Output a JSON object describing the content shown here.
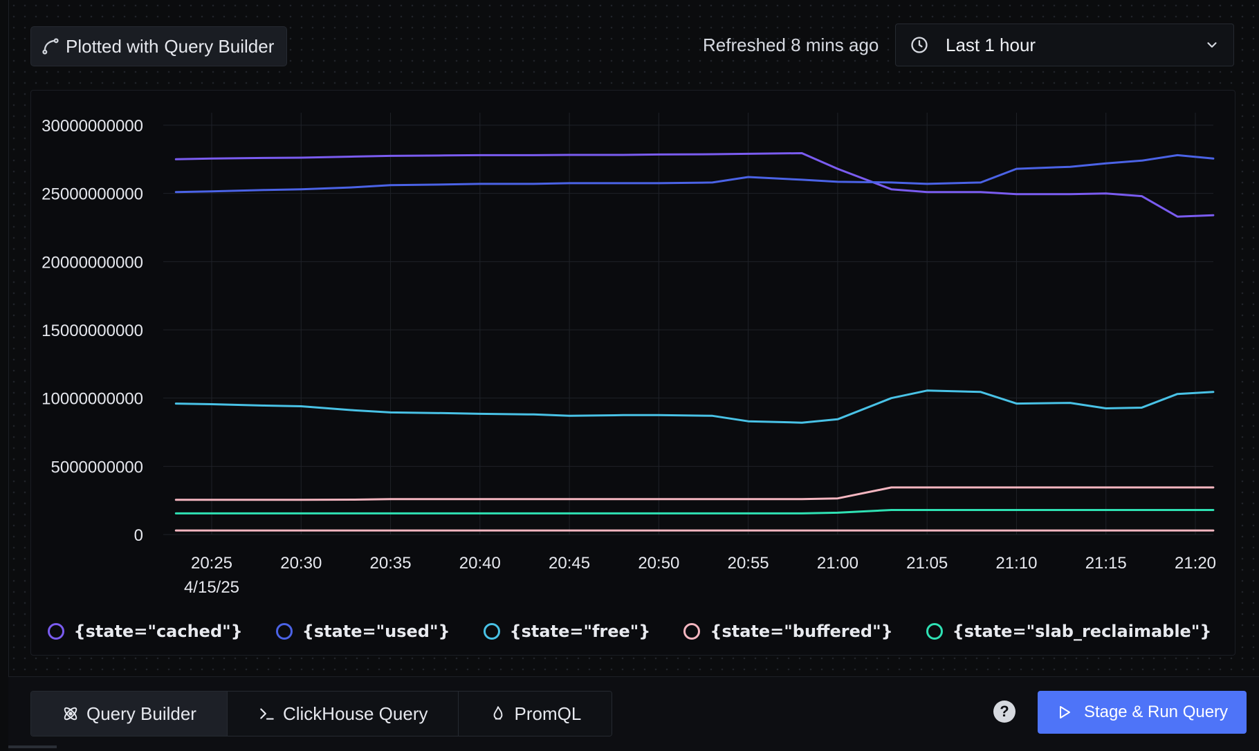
{
  "header": {
    "plotted_prefix": "Plotted with",
    "plotted_with": "Query Builder",
    "refreshed": "Refreshed 8 mins ago",
    "time_range": "Last 1 hour"
  },
  "chart_data": {
    "type": "line",
    "ylim": [
      0,
      30000000000
    ],
    "y_ticks": [
      "30000000000",
      "25000000000",
      "20000000000",
      "15000000000",
      "10000000000",
      "5000000000",
      "0"
    ],
    "x_ticks": [
      "20:25",
      "20:30",
      "20:35",
      "20:40",
      "20:45",
      "20:50",
      "20:55",
      "21:00",
      "21:05",
      "21:10",
      "21:15",
      "21:20"
    ],
    "x_date_label": "4/15/25",
    "grid": true,
    "x": [
      "20:23",
      "20:25",
      "20:28",
      "20:30",
      "20:33",
      "20:35",
      "20:38",
      "20:40",
      "20:43",
      "20:45",
      "20:48",
      "20:50",
      "20:53",
      "20:55",
      "20:58",
      "21:00",
      "21:03",
      "21:05",
      "21:08",
      "21:10",
      "21:13",
      "21:15",
      "21:17",
      "21:19",
      "21:21"
    ],
    "series": [
      {
        "name": "{state=\"cached\"}",
        "color": "#7a5cf0",
        "values": [
          27500000000,
          27550000000,
          27600000000,
          27620000000,
          27700000000,
          27750000000,
          27780000000,
          27800000000,
          27800000000,
          27820000000,
          27820000000,
          27850000000,
          27870000000,
          27900000000,
          27950000000,
          26800000000,
          25300000000,
          25100000000,
          25100000000,
          24950000000,
          24950000000,
          25000000000,
          24800000000,
          23300000000,
          23400000000
        ]
      },
      {
        "name": "{state=\"used\"}",
        "color": "#4b63e6",
        "values": [
          25100000000,
          25150000000,
          25250000000,
          25300000000,
          25450000000,
          25600000000,
          25650000000,
          25700000000,
          25700000000,
          25750000000,
          25750000000,
          25750000000,
          25800000000,
          26200000000,
          26000000000,
          25850000000,
          25800000000,
          25700000000,
          25800000000,
          26800000000,
          26950000000,
          27200000000,
          27400000000,
          27800000000,
          27550000000
        ]
      },
      {
        "name": "{state=\"free\"}",
        "color": "#49c2e6",
        "values": [
          9600000000,
          9550000000,
          9450000000,
          9400000000,
          9100000000,
          8950000000,
          8900000000,
          8850000000,
          8800000000,
          8700000000,
          8750000000,
          8750000000,
          8700000000,
          8300000000,
          8200000000,
          8450000000,
          10000000000,
          10550000000,
          10450000000,
          9600000000,
          9650000000,
          9250000000,
          9300000000,
          10300000000,
          10450000000
        ]
      },
      {
        "name": "{state=\"buffered\"}",
        "color": "#f5b6c0",
        "values": [
          2550000000,
          2550000000,
          2550000000,
          2550000000,
          2560000000,
          2600000000,
          2600000000,
          2600000000,
          2600000000,
          2600000000,
          2600000000,
          2600000000,
          2600000000,
          2600000000,
          2600000000,
          2650000000,
          3450000000,
          3450000000,
          3450000000,
          3450000000,
          3450000000,
          3450000000,
          3450000000,
          3450000000,
          3450000000
        ]
      },
      {
        "name": "{state=\"slab_reclaimable\"}",
        "color": "#2fe1b4",
        "values": [
          1550000000,
          1550000000,
          1550000000,
          1550000000,
          1550000000,
          1550000000,
          1550000000,
          1550000000,
          1550000000,
          1550000000,
          1550000000,
          1550000000,
          1550000000,
          1550000000,
          1550000000,
          1600000000,
          1800000000,
          1800000000,
          1800000000,
          1800000000,
          1800000000,
          1800000000,
          1800000000,
          1800000000,
          1800000000
        ]
      },
      {
        "name": "",
        "color": "#f5b6c0",
        "values": [
          300000000,
          300000000,
          300000000,
          300000000,
          300000000,
          300000000,
          300000000,
          300000000,
          300000000,
          300000000,
          300000000,
          300000000,
          300000000,
          300000000,
          300000000,
          300000000,
          300000000,
          300000000,
          300000000,
          300000000,
          300000000,
          300000000,
          300000000,
          300000000,
          300000000
        ]
      }
    ]
  },
  "legend": [
    {
      "label": "{state=\"cached\"}",
      "color": "#7a5cf0"
    },
    {
      "label": "{state=\"used\"}",
      "color": "#4b63e6"
    },
    {
      "label": "{state=\"free\"}",
      "color": "#49c2e6"
    },
    {
      "label": "{state=\"buffered\"}",
      "color": "#f5b6c0"
    },
    {
      "label": "{state=\"slab_reclaimable\"}",
      "color": "#2fe1b4"
    }
  ],
  "bottom": {
    "tabs": [
      {
        "label": "Query Builder",
        "icon": "atom-icon",
        "active": true
      },
      {
        "label": "ClickHouse Query",
        "icon": "terminal-icon",
        "active": false
      },
      {
        "label": "PromQL",
        "icon": "flame-icon",
        "active": false
      }
    ],
    "help_label": "?",
    "run_label": "Stage & Run Query"
  }
}
